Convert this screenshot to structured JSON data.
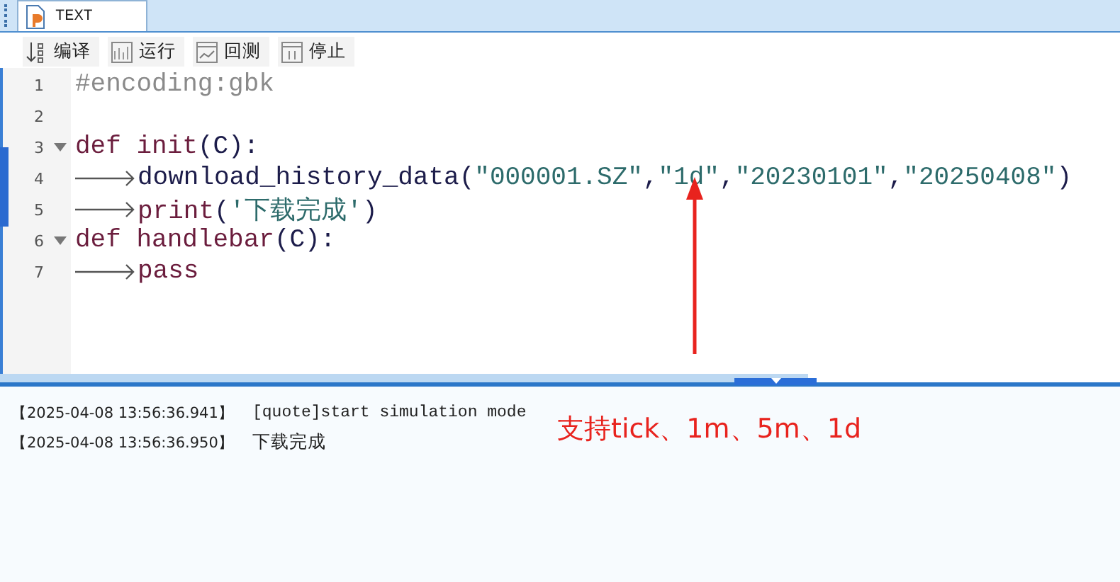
{
  "tab": {
    "title": "TEXT",
    "selected": true
  },
  "toolbar": [
    {
      "label": "编译",
      "kind": "compile"
    },
    {
      "label": "运行",
      "kind": "run"
    },
    {
      "label": "回测",
      "kind": "backtest"
    },
    {
      "label": "停止",
      "kind": "stop"
    }
  ],
  "code_lines": [
    {
      "number": "1",
      "foldable": false,
      "indent": false,
      "tokens": [
        {
          "text": "#encoding:gbk",
          "kind": "comment"
        }
      ]
    },
    {
      "number": "2",
      "foldable": false,
      "indent": false
    },
    {
      "number": "3",
      "foldable": true,
      "indent": false,
      "tokens": [
        {
          "text": "def ",
          "kind": "keyword"
        },
        {
          "text": "init",
          "kind": "name"
        },
        {
          "text": "(C):",
          "kind": "plain"
        }
      ]
    },
    {
      "number": "4",
      "foldable": false,
      "indent": true,
      "tokens": [
        {
          "text": "download_history_data(",
          "kind": "plain"
        },
        {
          "text": "\"000001.SZ\"",
          "kind": "string"
        },
        {
          "text": ",",
          "kind": "plain"
        },
        {
          "text": "\"1d\"",
          "kind": "string"
        },
        {
          "text": ",",
          "kind": "plain"
        },
        {
          "text": "\"20230101\"",
          "kind": "string"
        },
        {
          "text": ",",
          "kind": "plain"
        },
        {
          "text": "\"20250408\"",
          "kind": "string"
        },
        {
          "text": ")",
          "kind": "plain"
        }
      ]
    },
    {
      "number": "5",
      "foldable": false,
      "indent": true,
      "tokens": [
        {
          "text": "print",
          "kind": "name"
        },
        {
          "text": "(",
          "kind": "plain"
        },
        {
          "text": "'下载完成'",
          "kind": "string"
        },
        {
          "text": ")",
          "kind": "plain"
        }
      ]
    },
    {
      "number": "6",
      "foldable": true,
      "indent": false,
      "tokens": [
        {
          "text": "def ",
          "kind": "keyword"
        },
        {
          "text": "handlebar",
          "kind": "name"
        },
        {
          "text": "(C):",
          "kind": "plain"
        }
      ]
    },
    {
      "number": "7",
      "foldable": false,
      "indent": true,
      "tokens": [
        {
          "text": "pass",
          "kind": "name"
        }
      ]
    }
  ],
  "log": [
    {
      "time": "【2025-04-08 13:56:36.941】",
      "message": "[quote]start simulation mode"
    },
    {
      "time": "【2025-04-08 13:56:36.950】",
      "message": "下载完成"
    }
  ],
  "annotation": "支持tick、1m、5m、1d"
}
